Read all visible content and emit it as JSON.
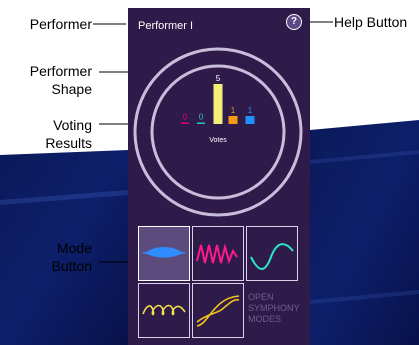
{
  "callouts": {
    "performer": "Performer",
    "performer_shape_line1": "Performer",
    "performer_shape_line2": "Shape",
    "voting_results_line1": "Voting",
    "voting_results_line2": "Results",
    "mode_button_line1": "Mode",
    "mode_button_line2": "Button",
    "help_button": "Help Button"
  },
  "header": {
    "title": "Performer I",
    "help_symbol": "?"
  },
  "votes": {
    "label": "Votes",
    "bars": [
      {
        "value": 0,
        "color": "#e4007c"
      },
      {
        "value": 0,
        "color": "#26c9b9"
      },
      {
        "value": 5,
        "color": "#f3f07a"
      },
      {
        "value": 1,
        "color": "#f39c12"
      },
      {
        "value": 1,
        "color": "#1e90ff"
      }
    ]
  },
  "modes": {
    "items": [
      {
        "name": "blue-lens-mode",
        "color": "#2f8cff",
        "active": true
      },
      {
        "name": "magenta-zigzag-mode",
        "color": "#ff1a8c",
        "active": false
      },
      {
        "name": "teal-sine-mode",
        "color": "#2ee6c8",
        "active": false
      },
      {
        "name": "yellow-loops-mode",
        "color": "#f5e04a",
        "active": false
      },
      {
        "name": "yellow-crossing-waves-mode",
        "color": "#f5c21a",
        "active": false
      }
    ],
    "open_label_line1": "OPEN",
    "open_label_line2": "SYMPHONY",
    "open_label_line3": "MODES"
  },
  "colors": {
    "panel": "#2f1b4a",
    "ring": "#c8bedc",
    "background": "#ffffff",
    "backdrop_blue": "#0b1c5c"
  }
}
